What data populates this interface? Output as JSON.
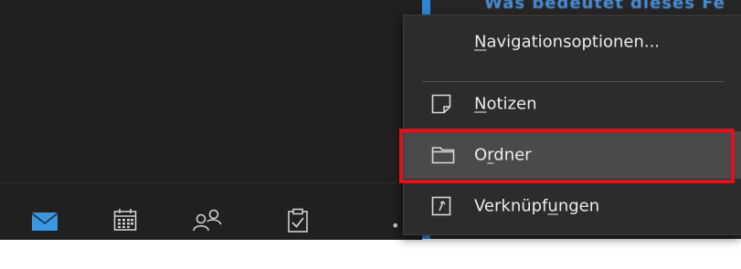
{
  "header": {
    "partial_text": "Was bedeutet dieses Fe"
  },
  "nav_bar": {
    "items": [
      {
        "icon": "mail-icon",
        "active": true
      },
      {
        "icon": "calendar-icon",
        "active": false
      },
      {
        "icon": "people-icon",
        "active": false
      },
      {
        "icon": "tasks-icon",
        "active": false
      },
      {
        "icon": "more-icon",
        "label": "..."
      }
    ],
    "more_label": "•••"
  },
  "menu": {
    "items": [
      {
        "pre": "",
        "accel": "N",
        "post": "avigationsoptionen...",
        "icon": null
      },
      {
        "pre": "",
        "accel": "N",
        "post": "otizen",
        "icon": "note-icon"
      },
      {
        "pre": "O",
        "accel": "r",
        "post": "dner",
        "icon": "folder-icon",
        "selected": true
      },
      {
        "pre": "Verknüpf",
        "accel": "u",
        "post": "ngen",
        "icon": "shortcut-icon"
      }
    ]
  },
  "colors": {
    "background": "#202020",
    "menu_bg": "#2c2c2c",
    "selected_bg": "#4a4a4a",
    "highlight_border": "#e0121b",
    "accent": "#2e86d6"
  }
}
